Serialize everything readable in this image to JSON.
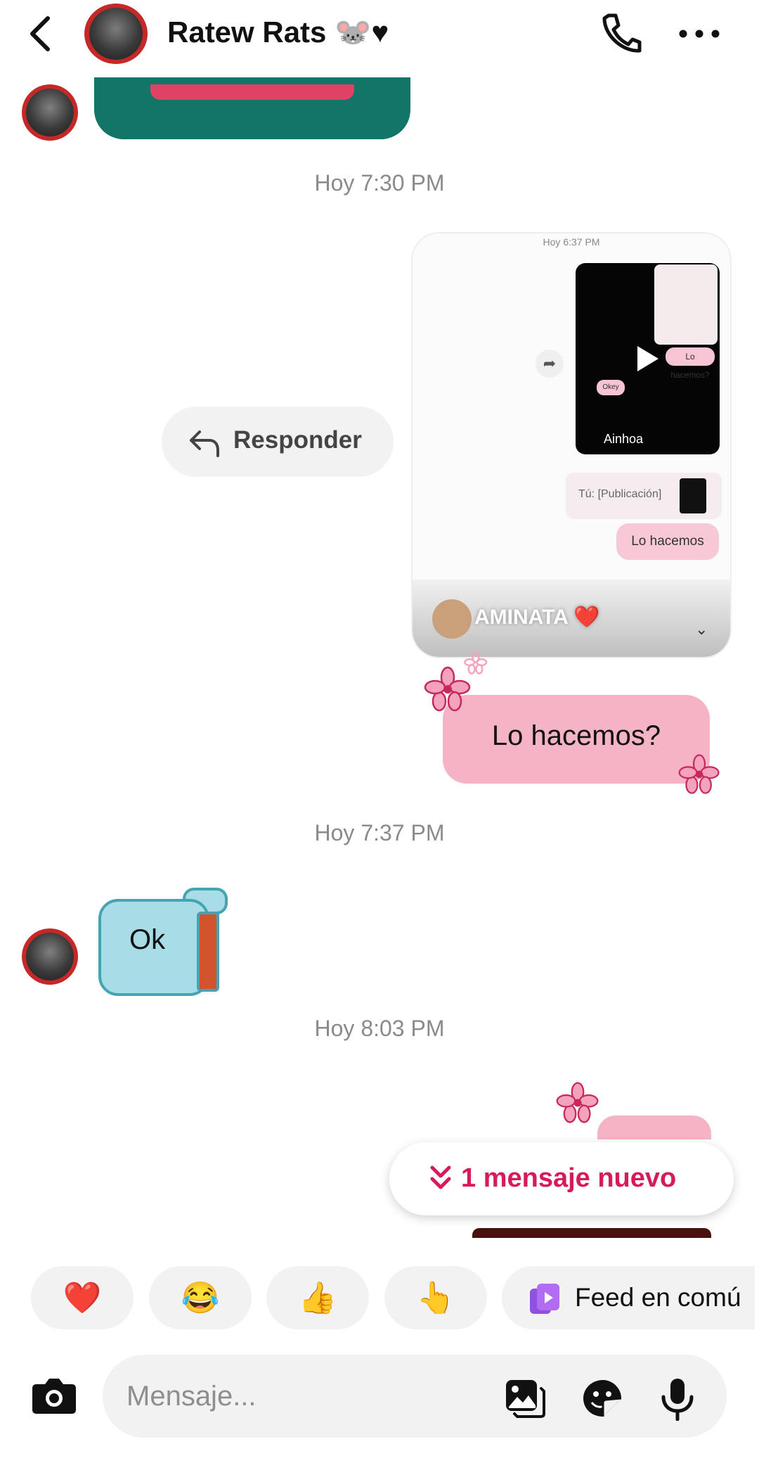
{
  "header": {
    "title": "Ratew Rats 🐭♥"
  },
  "chat": {
    "timestamps": [
      "Hoy 7:30 PM",
      "Hoy 7:37 PM",
      "Hoy 8:03 PM"
    ],
    "shared_post": {
      "inner_time": "Hoy 6:37 PM",
      "inner_name": "Ainhoa",
      "inner_pink_label": "Lo hacemos?",
      "inner_okey": "Okey",
      "inner_tu": "Tú: [Publicación]",
      "inner_lo": "Lo hacemos",
      "author": "AMINATA ❤️"
    },
    "reply_label": "Responder",
    "pink_message": "Lo hacemos?",
    "sticker_text": "Ok",
    "new_message_label": "1 mensaje nuevo"
  },
  "quick_reactions": {
    "emojis": [
      "❤️",
      "😂",
      "👍",
      "👆"
    ],
    "feed_label": "Feed en comú"
  },
  "composer": {
    "placeholder": "Mensaje..."
  },
  "colors": {
    "accent": "#d61a5a",
    "teal": "#137568",
    "pink_bubble": "#f5b3c6",
    "chip_bg": "#f2f2f2"
  }
}
